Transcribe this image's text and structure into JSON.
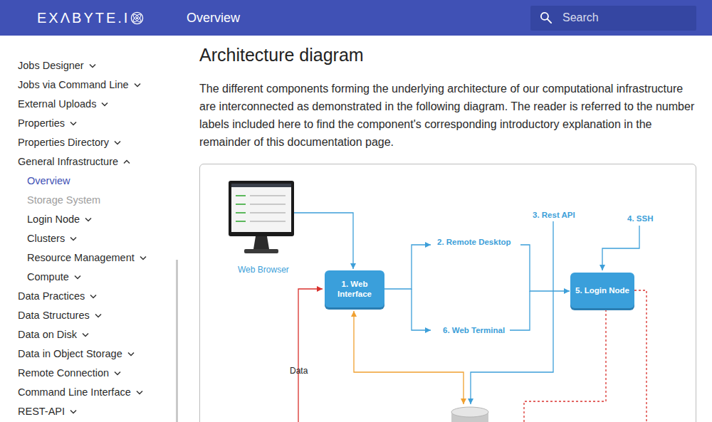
{
  "header": {
    "logo": "EXΛBYTE.I",
    "title": "Overview"
  },
  "search": {
    "placeholder": "Search"
  },
  "sidebar": {
    "items": [
      {
        "label": "Jobs Designer",
        "kind": "group",
        "expanded": false,
        "selected": false,
        "greyed": false
      },
      {
        "label": "Jobs via Command Line",
        "kind": "group",
        "expanded": false,
        "selected": false,
        "greyed": false
      },
      {
        "label": "External Uploads",
        "kind": "group",
        "expanded": false,
        "selected": false,
        "greyed": false
      },
      {
        "label": "Properties",
        "kind": "group",
        "expanded": false,
        "selected": false,
        "greyed": false
      },
      {
        "label": "Properties Directory",
        "kind": "group",
        "expanded": false,
        "selected": false,
        "greyed": false
      },
      {
        "label": "General Infrastructure",
        "kind": "group",
        "expanded": true,
        "selected": false,
        "greyed": false,
        "children": [
          {
            "label": "Overview",
            "kind": "page",
            "expanded": false,
            "selected": true,
            "greyed": false
          },
          {
            "label": "Storage System",
            "kind": "page",
            "expanded": false,
            "selected": false,
            "greyed": true
          },
          {
            "label": "Login Node",
            "kind": "group",
            "expanded": false,
            "selected": false,
            "greyed": false
          },
          {
            "label": "Clusters",
            "kind": "group",
            "expanded": false,
            "selected": false,
            "greyed": false
          },
          {
            "label": "Resource Management",
            "kind": "group",
            "expanded": false,
            "selected": false,
            "greyed": false
          },
          {
            "label": "Compute",
            "kind": "group",
            "expanded": false,
            "selected": false,
            "greyed": false
          }
        ]
      },
      {
        "label": "Data Practices",
        "kind": "group",
        "expanded": false,
        "selected": false,
        "greyed": false
      },
      {
        "label": "Data Structures",
        "kind": "group",
        "expanded": false,
        "selected": false,
        "greyed": false
      },
      {
        "label": "Data on Disk",
        "kind": "group",
        "expanded": false,
        "selected": false,
        "greyed": false
      },
      {
        "label": "Data in Object Storage",
        "kind": "group",
        "expanded": false,
        "selected": false,
        "greyed": false
      },
      {
        "label": "Remote Connection",
        "kind": "group",
        "expanded": false,
        "selected": false,
        "greyed": false
      },
      {
        "label": "Command Line Interface",
        "kind": "group",
        "expanded": false,
        "selected": false,
        "greyed": false
      },
      {
        "label": "REST-API",
        "kind": "group",
        "expanded": false,
        "selected": false,
        "greyed": false
      }
    ]
  },
  "content": {
    "heading": "Architecture diagram",
    "paragraph": "The different components forming the underlying architecture of our computational infrastructure are interconnected as demonstrated in the following diagram. The reader is referred to the number labels included here to find the component's corresponding introductory explanation in the remainder of this documentation page."
  },
  "diagram": {
    "nodes": [
      {
        "label": "Web Browser",
        "kind": "caption"
      },
      {
        "label": "1. Web Interface",
        "kind": "service"
      },
      {
        "label": "2. Remote Desktop",
        "kind": "link"
      },
      {
        "label": "6. Web Terminal",
        "kind": "link"
      },
      {
        "label": "3. Rest API",
        "kind": "link"
      },
      {
        "label": "4. SSH",
        "kind": "link"
      },
      {
        "label": "5. Login Node",
        "kind": "service"
      },
      {
        "label": "Data",
        "kind": "edge-label"
      }
    ],
    "edges": [
      {
        "color": "#3d9fd9",
        "dashed": false
      },
      {
        "color": "#3d9fd9",
        "dashed": false
      },
      {
        "color": "#3d9fd9",
        "dashed": false
      },
      {
        "color": "#3d9fd9",
        "dashed": false
      },
      {
        "color": "#3d9fd9",
        "dashed": false
      },
      {
        "color": "#3d9fd9",
        "dashed": false
      },
      {
        "color": "#3d9fd9",
        "dashed": false
      },
      {
        "color": "#d9302c",
        "dashed": false
      },
      {
        "color": "#f0a030",
        "dashed": false
      },
      {
        "color": "#d9302c",
        "dashed": true
      },
      {
        "color": "#d9302c",
        "dashed": true
      }
    ]
  }
}
